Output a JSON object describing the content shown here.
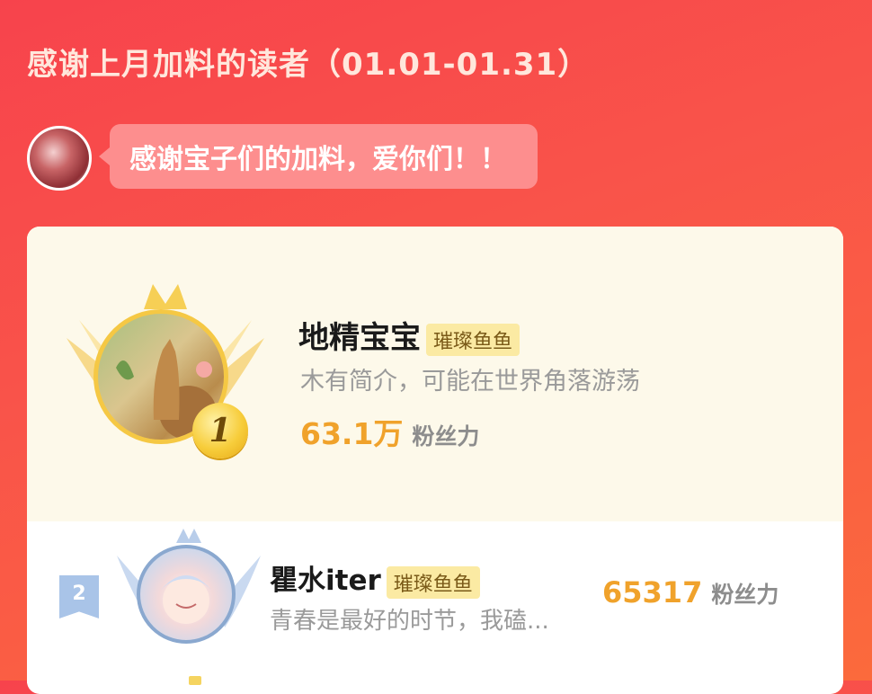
{
  "header": {
    "title": "感谢上月加料的读者（01.01-01.31）",
    "bubble_text": "感谢宝子们的加料，爱你们！！"
  },
  "ranking": [
    {
      "rank": "1",
      "name": "地精宝宝",
      "badge": "璀璨鱼鱼",
      "bio": "木有简介，可能在世界角落游荡",
      "fans_value": "63.1万",
      "fans_label": "粉丝力"
    },
    {
      "rank": "2",
      "name": "瞿水iter",
      "badge": "璀璨鱼鱼",
      "bio": "青春是最好的时节，我磕...",
      "fans_value": "65317",
      "fans_label": "粉丝力"
    }
  ],
  "colors": {
    "background": "#f7434c",
    "fans_number": "#f0a22b",
    "badge_bg": "#fbeaa3",
    "first_card_bg": "#fdf9ea"
  }
}
